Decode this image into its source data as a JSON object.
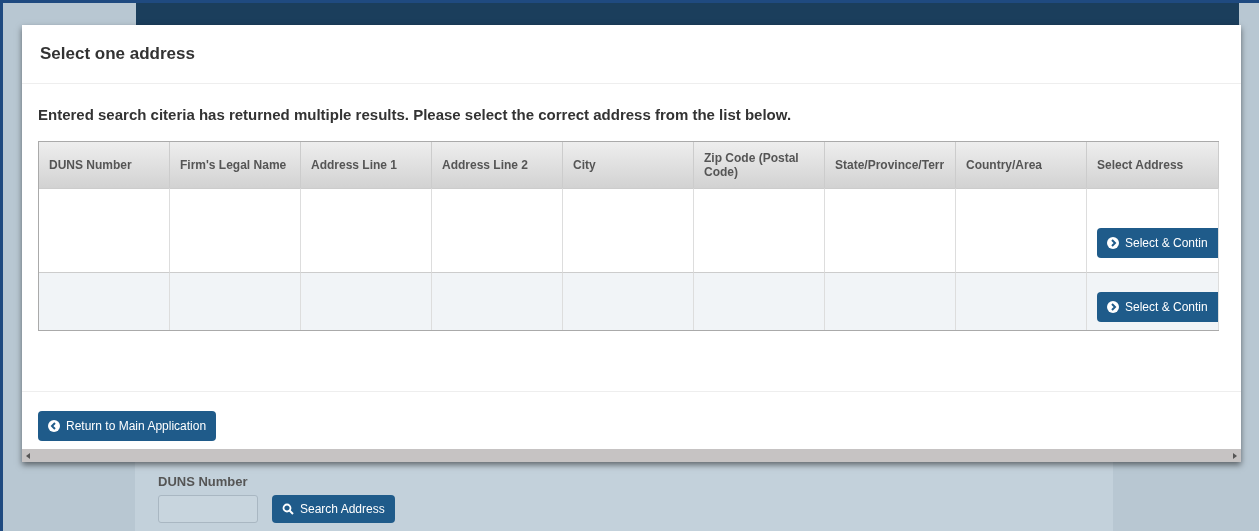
{
  "modal": {
    "title": "Select one address",
    "message": "Entered search citeria has returned multiple results. Please select the correct address from the list below.",
    "table": {
      "columns": [
        "DUNS Number",
        "Firm's Legal Name",
        "Address Line 1",
        "Address Line 2",
        "City",
        "Zip Code (Postal Code)",
        "State/Province/Terr",
        "Country/Area",
        "Select Address"
      ],
      "rows": [
        {
          "action": "Select & Contin",
          "striped": false
        },
        {
          "action": "Select & Contin",
          "striped": true
        }
      ]
    },
    "return_button": "Return to Main Application"
  },
  "form": {
    "label": "DUNS Number",
    "search_button": "Search Address"
  }
}
